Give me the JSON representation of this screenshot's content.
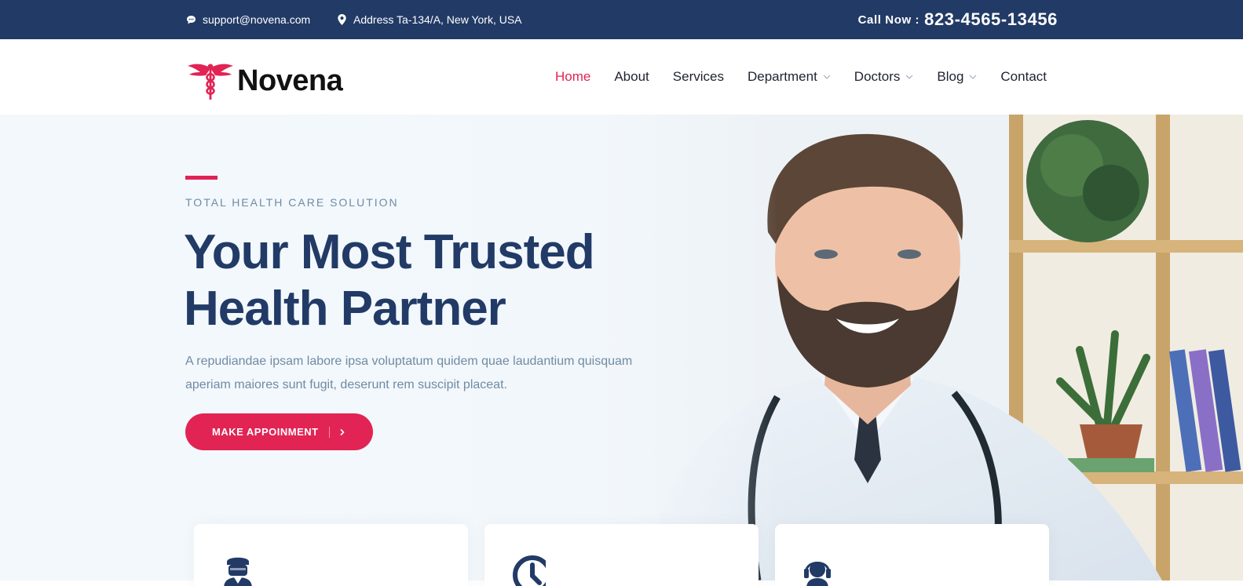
{
  "topbar": {
    "email": "support@novena.com",
    "address": "Address Ta-134/A, New York, USA",
    "call_label": "Call Now :",
    "call_number": "823-4565-13456"
  },
  "brand": {
    "name": "Novena",
    "logo_icon": "caduceus-icon"
  },
  "nav": {
    "items": [
      {
        "label": "Home",
        "active": true,
        "dropdown": false
      },
      {
        "label": "About",
        "active": false,
        "dropdown": false
      },
      {
        "label": "Services",
        "active": false,
        "dropdown": false
      },
      {
        "label": "Department",
        "active": false,
        "dropdown": true
      },
      {
        "label": "Doctors",
        "active": false,
        "dropdown": true
      },
      {
        "label": "Blog",
        "active": false,
        "dropdown": true
      },
      {
        "label": "Contact",
        "active": false,
        "dropdown": false
      }
    ]
  },
  "hero": {
    "subtitle": "TOTAL HEALTH CARE SOLUTION",
    "title_line1": "Your Most Trusted",
    "title_line2": "Health Partner",
    "description": "A repudiandae ipsam labore ipsa voluptatum quidem quae laudantium quisquam aperiam maiores sunt fugit, deserunt rem suscipit placeat.",
    "button_label": "MAKE APPOINMENT",
    "image": "smiling-doctor-with-stethoscope"
  },
  "features": [
    {
      "icon": "surgeon-icon"
    },
    {
      "icon": "clock-icon"
    },
    {
      "icon": "headset-support-icon"
    }
  ],
  "colors": {
    "primary": "#223a66",
    "accent": "#e12454",
    "muted": "#6f8ba4"
  }
}
